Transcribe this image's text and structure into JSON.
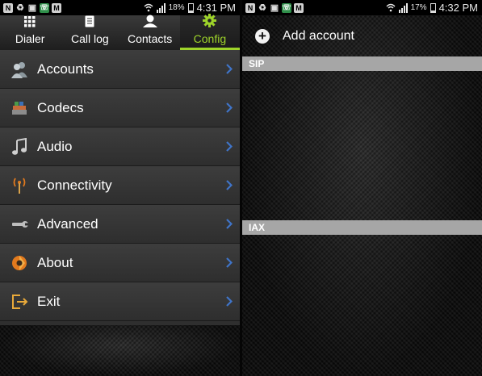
{
  "left_status": {
    "badges": [
      "N",
      "♻",
      "▣",
      "☏",
      "M"
    ],
    "battery": "18%",
    "time": "4:31 PM"
  },
  "tabs": [
    {
      "label": "Dialer",
      "icon": "dialpad-grid-icon",
      "active": false
    },
    {
      "label": "Call log",
      "icon": "call-log-list-icon",
      "active": false
    },
    {
      "label": "Contacts",
      "icon": "contact-person-icon",
      "active": false
    },
    {
      "label": "Config",
      "icon": "gear-icon",
      "active": true
    }
  ],
  "menu": {
    "items": [
      {
        "label": "Accounts",
        "icon": "accounts-people-icon"
      },
      {
        "label": "Codecs",
        "icon": "codecs-stack-icon"
      },
      {
        "label": "Audio",
        "icon": "music-note-icon"
      },
      {
        "label": "Connectivity",
        "icon": "antenna-icon"
      },
      {
        "label": "Advanced",
        "icon": "wrench-icon"
      },
      {
        "label": "About",
        "icon": "about-app-icon"
      },
      {
        "label": "Exit",
        "icon": "exit-door-icon"
      }
    ]
  },
  "right_status": {
    "badges": [
      "N",
      "♻",
      "▣",
      "☏",
      "M"
    ],
    "battery": "17%",
    "time": "4:32 PM"
  },
  "accounts": {
    "add_label": "Add account",
    "sections": [
      "SIP",
      "IAX"
    ]
  },
  "colors": {
    "accent": "#9ed42a",
    "chevron": "#3f74c8",
    "section_header": "#a6a6a6"
  }
}
